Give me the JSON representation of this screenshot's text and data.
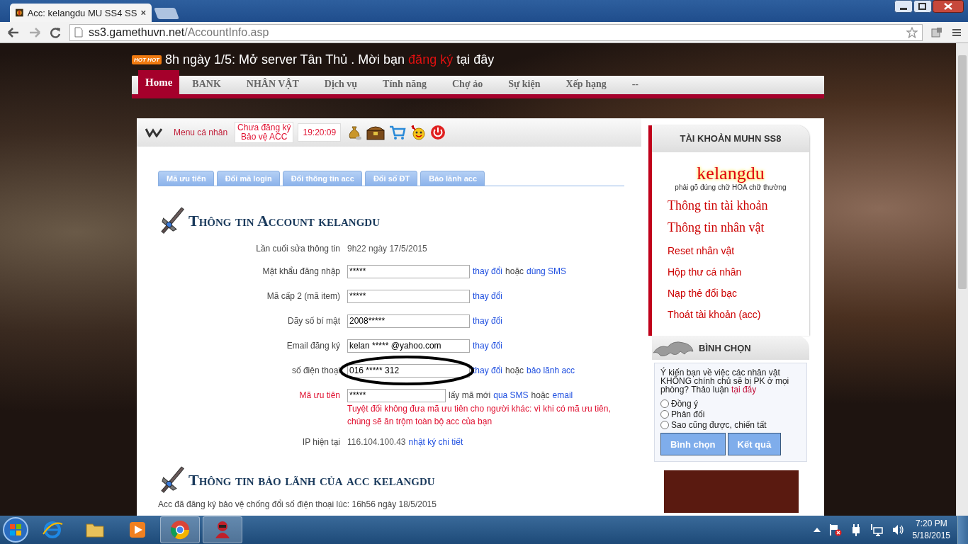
{
  "browser": {
    "tabs": [
      {
        "title": "Acc: kelangdu MU SS4 SS",
        "selected": true
      }
    ],
    "url": {
      "host": "ss3.gamethuvn.net",
      "path": "/AccountInfo.asp"
    }
  },
  "banner": {
    "badge": "HOT HOT",
    "text": "8h ngày 1/5: Mở server Tân Thủ . Mời bạn",
    "link": "đăng ký",
    "tail": "tại đây"
  },
  "nav": [
    {
      "label": "Home",
      "selected": true
    },
    {
      "label": "BANK",
      "selected": false
    },
    {
      "label": "NHÂN VẬT",
      "selected": false
    },
    {
      "label": "Dịch vụ",
      "selected": false
    },
    {
      "label": "Tính năng",
      "selected": false
    },
    {
      "label": "Chợ ảo",
      "selected": false
    },
    {
      "label": "Sự kiện",
      "selected": false
    },
    {
      "label": "Xếp hạng",
      "selected": false
    },
    {
      "label": "--",
      "selected": false
    }
  ],
  "user_bar": {
    "menu_label": "Menu cá nhân",
    "protect_badge": [
      "Chưa đăng ký",
      "Bảo vệ ACC"
    ],
    "time": "19:20:09"
  },
  "tabs": [
    {
      "label": "Mã ưu tiên",
      "selected": false
    },
    {
      "label": "Đổi mã login",
      "selected": false
    },
    {
      "label": "Đổi thông tin acc",
      "selected": false
    },
    {
      "label": "Đổi số ĐT",
      "selected": false
    },
    {
      "label": "Bảo lãnh acc",
      "selected": false
    }
  ],
  "account_section": {
    "title": "Thông tin Account kelangdu",
    "rows": [
      {
        "kind": "text",
        "label": "Lần cuối sửa thông tin",
        "value": "9h22 ngày 17/5/2015",
        "actions": []
      },
      {
        "kind": "field",
        "label": "Mật khẩu đăng nhập",
        "value": "*****",
        "actions": [
          {
            "kind": "link",
            "text": "thay đổi"
          },
          {
            "kind": "plain",
            "text": "hoặc"
          },
          {
            "kind": "link",
            "text": "dùng SMS"
          }
        ]
      },
      {
        "kind": "field",
        "label": "Mã cấp 2 (mã item)",
        "value": "*****",
        "actions": [
          {
            "kind": "link",
            "text": "thay đổi"
          }
        ]
      },
      {
        "kind": "field",
        "label": "Dãy số bí mật",
        "value": "2008*****",
        "actions": [
          {
            "kind": "link",
            "text": "thay đổi"
          }
        ]
      },
      {
        "kind": "field",
        "label": "Email đăng ký",
        "value": "kelan ***** @yahoo.com",
        "actions": [
          {
            "kind": "link",
            "text": "thay đổi"
          }
        ]
      },
      {
        "kind": "field",
        "label": "số điện thoại",
        "value": "016 ***** 312",
        "circled": true,
        "actions": [
          {
            "kind": "link",
            "text": "thay đổi"
          },
          {
            "kind": "plain",
            "text": "hoặc"
          },
          {
            "kind": "link",
            "text": "bảo lãnh acc"
          }
        ]
      },
      {
        "kind": "code",
        "label": "Mã ưu tiên",
        "value": "*****",
        "actions": [
          {
            "kind": "plain",
            "text": "lấy mã mới"
          },
          {
            "kind": "link",
            "text": "qua SMS"
          },
          {
            "kind": "plain",
            "text": "hoặc"
          },
          {
            "kind": "link",
            "text": "email"
          }
        ],
        "warning": "Tuyệt đối không đưa mã ưu tiên cho người khác: vì khi có mã ưu tiên, chúng sẽ ăn trộm toàn bộ acc của bạn"
      },
      {
        "kind": "text",
        "label": "IP hiện tại",
        "value": "116.104.100.43",
        "actions": [
          {
            "kind": "link",
            "text": "nhật ký chi tiết"
          }
        ]
      }
    ]
  },
  "guarantee_section": {
    "title": "Thông tin bảo lãnh của acc kelangdu",
    "note": "Acc đã đăng ký bảo vệ chống đổi số điện thoại lúc: 16h56 ngày 18/5/2015"
  },
  "account_box": {
    "title": "TÀI KHOẢN MUHN SS8",
    "username": "kelangdu",
    "hint": "phải gõ đúng chữ HOA chữ thường",
    "links": [
      {
        "kind": "primary",
        "text": "Thông tin tài khoản"
      },
      {
        "kind": "primary",
        "text": "Thông tin nhân vật"
      },
      {
        "kind": "secondary",
        "text": "Reset nhân vật"
      },
      {
        "kind": "secondary",
        "text": "Hộp thư cá nhân"
      },
      {
        "kind": "secondary",
        "text": "Nạp thẻ đổi bạc"
      },
      {
        "kind": "secondary",
        "text": "Thoát tài khoản (acc)"
      }
    ]
  },
  "poll": {
    "title": "BÌNH CHỌN",
    "question": "Ý kiến bạn về việc các nhân vật KHÔNG chính chủ sẽ bị PK ở mọi phòng? Thảo luận",
    "link": "tại đây",
    "options": [
      {
        "label": "Đồng ý",
        "selected": false
      },
      {
        "label": "Phản đối",
        "selected": false
      },
      {
        "label": "Sao cũng được, chiến tất",
        "selected": false
      }
    ],
    "buttons": [
      "Bình chọn",
      "Kết quả"
    ]
  },
  "taskbar": {
    "apps": [
      {
        "kind": "browser-e",
        "running": false
      },
      {
        "kind": "folder",
        "running": false
      },
      {
        "kind": "media",
        "running": false
      },
      {
        "kind": "chrome",
        "running": true
      },
      {
        "kind": "game",
        "running": true
      }
    ],
    "time": "7:20 PM",
    "date": "5/18/2015"
  }
}
